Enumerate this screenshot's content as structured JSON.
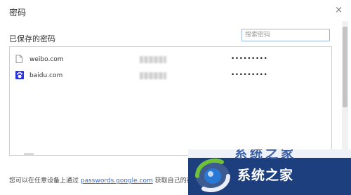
{
  "dialog": {
    "title": "密码",
    "close_glyph": "×",
    "section_title": "已保存的密码",
    "search_placeholder": "搜索密码"
  },
  "passwords": [
    {
      "site": "weibo.com",
      "icon": "page-icon",
      "password_mask": "•••••••••"
    },
    {
      "site": "baidu.com",
      "icon": "baidu-paw-icon",
      "password_mask": "•••••••••"
    }
  ],
  "footer": {
    "prefix": "您可以在任意设备上通过",
    "link": "passwords.google.com",
    "suffix": "获取自己的密"
  },
  "watermark": {
    "strip_text": "系统之家",
    "text": "系统之家"
  },
  "colors": {
    "link": "#3367d6",
    "search_border": "#9ab6e6",
    "watermark_bg": "#1d3f7e"
  }
}
